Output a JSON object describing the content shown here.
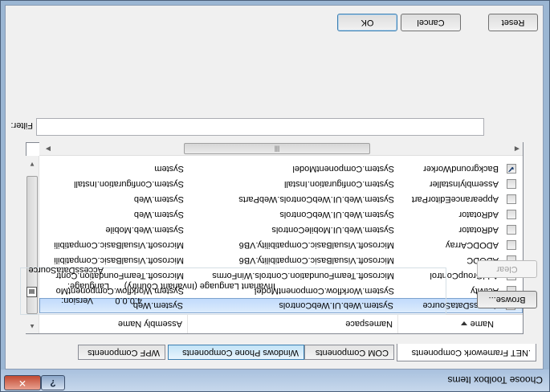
{
  "window": {
    "title": "Choose Toolbox Items",
    "help_label": "?",
    "close_label": "✕"
  },
  "tabs": [
    {
      "label": ".NET Framework Components",
      "active": true
    },
    {
      "label": "COM Components",
      "active": false
    },
    {
      "label": "Windows Phone Components",
      "active": false
    },
    {
      "label": "WPF Components",
      "active": false
    }
  ],
  "list": {
    "columns": [
      "Name",
      "Namespace",
      "Assembly Name"
    ],
    "rows": [
      {
        "name": "AccessDataSource",
        "namespace": "System.Web.UI.WebControls",
        "assembly": "System.Web",
        "checked": false,
        "selected": true
      },
      {
        "name": "Activity",
        "namespace": "System.Workflow.ComponentModel",
        "assembly": "System.Workflow.ComponentMo",
        "checked": false,
        "selected": false
      },
      {
        "name": "AddGroupControl",
        "namespace": "Microsoft.TeamFoundation.Controls.WinForms",
        "assembly": "Microsoft.TeamFoundation.Contr",
        "checked": false,
        "selected": false
      },
      {
        "name": "ADODC",
        "namespace": "Microsoft.VisualBasic.Compatibility.VB6",
        "assembly": "Microsoft.VisualBasic.Compatibili",
        "checked": false,
        "selected": false
      },
      {
        "name": "ADODCArray",
        "namespace": "Microsoft.VisualBasic.Compatibility.VB6",
        "assembly": "Microsoft.VisualBasic.Compatibili",
        "checked": false,
        "selected": false
      },
      {
        "name": "AdRotator",
        "namespace": "System.Web.UI.MobileControls",
        "assembly": "System.Web.Mobile",
        "checked": false,
        "selected": false
      },
      {
        "name": "AdRotator",
        "namespace": "System.Web.UI.WebControls",
        "assembly": "System.Web",
        "checked": false,
        "selected": false
      },
      {
        "name": "AppearanceEditorPart",
        "namespace": "System.Web.UI.WebControls.WebParts",
        "assembly": "System.Web",
        "checked": false,
        "selected": false
      },
      {
        "name": "AssemblyInstaller",
        "namespace": "System.Configuration.Install",
        "assembly": "System.Configuration.Install",
        "checked": false,
        "selected": false
      },
      {
        "name": "BackgroundWorker",
        "namespace": "System.ComponentModel",
        "assembly": "System",
        "checked": true,
        "selected": false
      }
    ]
  },
  "filter": {
    "label": "Filter:",
    "value": "",
    "clear_label": "Clear"
  },
  "info": {
    "group_label": "AccessDataSource",
    "language_label": "Language:",
    "language_value": "Invariant Language (Invariant Country)",
    "version_label": "Version:",
    "version_value": "4.0.0.0",
    "browse_label": "Browse..."
  },
  "buttons": {
    "ok": "OK",
    "cancel": "Cancel",
    "reset": "Reset"
  }
}
